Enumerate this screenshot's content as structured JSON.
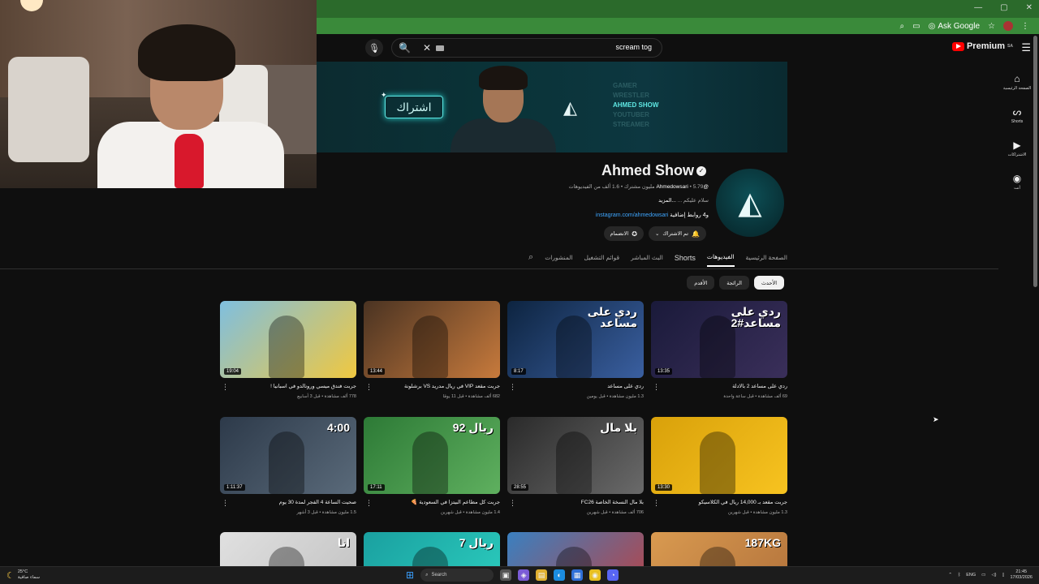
{
  "browser": {
    "ask_google": "Ask Google",
    "window_controls": [
      "—",
      "▢",
      "✕"
    ]
  },
  "header": {
    "search_query": "scream tog",
    "premium_label": "Premium",
    "premium_region": "SA"
  },
  "guide": {
    "items": [
      {
        "icon": "home-icon",
        "glyph": "⌂",
        "label": "الصفحة الرئيسية"
      },
      {
        "icon": "shorts-icon",
        "glyph": "ᔕ",
        "label": "Shorts"
      },
      {
        "icon": "subscriptions-icon",
        "glyph": "▶",
        "label": "الاشتراكات"
      },
      {
        "icon": "account-icon",
        "glyph": "◉",
        "label": "أنت"
      }
    ]
  },
  "banner": {
    "subscribe_text": "اشتراك",
    "roles": [
      "GAMER",
      "WRESTLER",
      "AHMED SHOW",
      "YOUTUBER",
      "STREAMER"
    ]
  },
  "channel": {
    "name": "Ahmed Show",
    "handle": "@Ahmedowsari",
    "subscribers": "5.79 مليون مشترك",
    "videos": "1.6 ألف من الفيديوهات",
    "description": "سلام عليكم ... ",
    "more": "...المزيد",
    "link": "instagram.com/ahmedowsari",
    "extra_links": "و4 روابط إضافية",
    "subscribed_label": "تم الاشتراك",
    "join_label": "الانضمام"
  },
  "tabs": [
    {
      "label": "الصفحة الرئيسية",
      "active": false
    },
    {
      "label": "الفيديوهات",
      "active": true
    },
    {
      "label": "Shorts",
      "active": false
    },
    {
      "label": "البث المباشر",
      "active": false
    },
    {
      "label": "قوائم التشغيل",
      "active": false
    },
    {
      "label": "المنشورات",
      "active": false
    }
  ],
  "chips": [
    {
      "label": "الأحدث",
      "active": true
    },
    {
      "label": "الرائجة",
      "active": false
    },
    {
      "label": "الأقدم",
      "active": false
    }
  ],
  "videos": [
    {
      "title": "ردي على مساعد 2 بالادلة",
      "meta": "69 ألف مشاهدة • قبل ساعة واحدة",
      "duration": "13:35",
      "thumb_text": "ردي على\nمساعد#2",
      "colors": [
        "#1a1a3a",
        "#3a2f5a"
      ]
    },
    {
      "title": "ردي على مساعد",
      "meta": "1.3 مليون مشاهدة • قبل يومين",
      "duration": "8:17",
      "thumb_text": "ردي على\nمساعد",
      "colors": [
        "#0d2440",
        "#3a5fa0"
      ]
    },
    {
      "title": "جربت مقعد VIP في ريال مدريد VS برشلونة",
      "meta": "682 ألف مشاهدة • قبل 11 يومًا",
      "duration": "13:44",
      "thumb_text": "",
      "colors": [
        "#4a3322",
        "#c77a3c"
      ]
    },
    {
      "title": "جربت فندق ميسي ورونالدو في اسبانيا !",
      "meta": "778 ألف مشاهدة • قبل 3 أسابيع",
      "duration": "19:04",
      "thumb_text": "",
      "colors": [
        "#7fbfdf",
        "#f0c840"
      ]
    },
    {
      "title": "جربت مقعد بـ 14,000 ريال في الكلاسيكو",
      "meta": "1.3 مليون مشاهدة • قبل شهرين",
      "duration": "13:30",
      "thumb_text": "",
      "colors": [
        "#d9a10a",
        "#f7c320"
      ]
    },
    {
      "title": "بلا مال النسخة الخاصة FC26",
      "meta": "706 ألف مشاهدة • قبل شهرين",
      "duration": "28:55",
      "thumb_text": "بلا مال",
      "colors": [
        "#2a2a2a",
        "#6a6a6a"
      ]
    },
    {
      "title": "جربت كل مطاعم البيتزا في السعودية 🍕",
      "meta": "1.4 مليون مشاهدة • قبل شهرين",
      "duration": "17:11",
      "thumb_text": "92 ريال",
      "colors": [
        "#2d7a36",
        "#5fb05f"
      ]
    },
    {
      "title": "صحيت الساعة 4 الفجر لمدة 30 يوم",
      "meta": "1.5 مليون مشاهدة • قبل 3 أشهر",
      "duration": "1:11:37",
      "thumb_text": "4:00",
      "colors": [
        "#2d3a4a",
        "#5a6a7a"
      ]
    },
    {
      "title": "",
      "meta": "",
      "duration": "",
      "thumb_text": "187KG",
      "colors": [
        "#d99a50",
        "#b0703a"
      ]
    },
    {
      "title": "",
      "meta": "",
      "duration": "",
      "thumb_text": "",
      "colors": [
        "#3a80c0",
        "#c04040"
      ]
    },
    {
      "title": "",
      "meta": "",
      "duration": "",
      "thumb_text": "7 ريال",
      "colors": [
        "#1aa0a0",
        "#2dd0c0"
      ]
    },
    {
      "title": "",
      "meta": "",
      "duration": "",
      "thumb_text": "انا",
      "colors": [
        "#e0e0e0",
        "#c0c0c0"
      ]
    }
  ],
  "taskbar": {
    "weather_temp": "25°C",
    "weather_desc": "سماء صافية",
    "search_label": "Search",
    "lang": "ENG",
    "time": "21:45",
    "date": "17/03/2026"
  }
}
